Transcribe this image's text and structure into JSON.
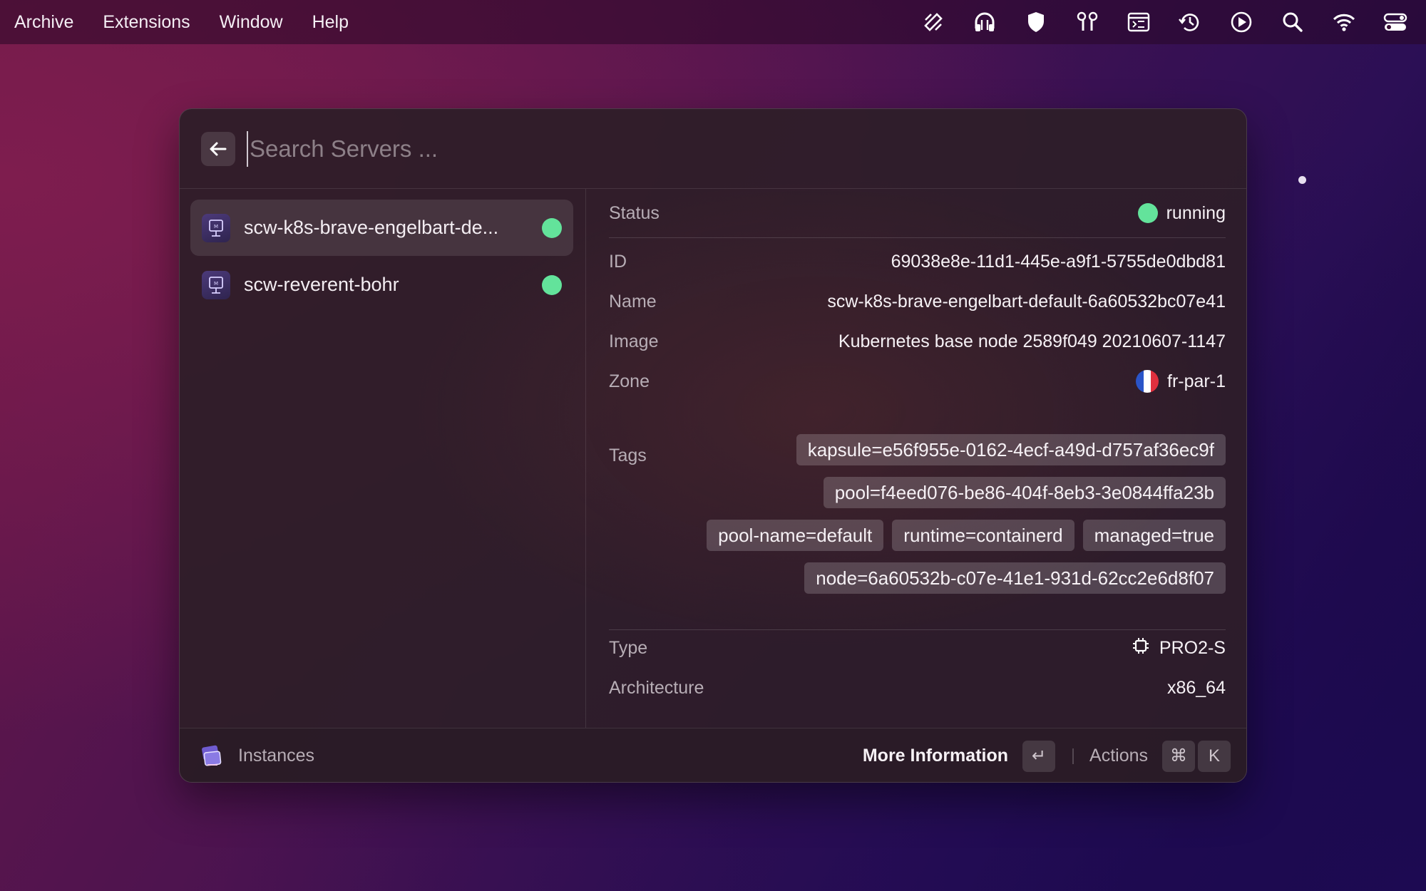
{
  "menubar": {
    "items": [
      "Archive",
      "Extensions",
      "Window",
      "Help"
    ],
    "status_icons": [
      "raycast-icon",
      "headphones-icon",
      "shield-icon",
      "airpods-icon",
      "keyboard-window-icon",
      "time-machine-icon",
      "play-circle-icon",
      "search-icon",
      "wifi-icon",
      "control-center-icon"
    ]
  },
  "search": {
    "placeholder": "Search Servers ...",
    "value": ""
  },
  "servers": [
    {
      "name": "scw-k8s-brave-engelbart-de...",
      "status": "running",
      "selected": true
    },
    {
      "name": "scw-reverent-bohr",
      "status": "running",
      "selected": false
    }
  ],
  "details": {
    "status_label": "Status",
    "status_value": "running",
    "id_label": "ID",
    "id_value": "69038e8e-11d1-445e-a9f1-5755de0dbd81",
    "name_label": "Name",
    "name_value": "scw-k8s-brave-engelbart-default-6a60532bc07e41",
    "image_label": "Image",
    "image_value": "Kubernetes base node 2589f049 20210607-1147",
    "zone_label": "Zone",
    "zone_value": "fr-par-1",
    "tags_label": "Tags",
    "tags": [
      "kapsule=e56f955e-0162-4ecf-a49d-d757af36ec9f",
      "pool=f4eed076-be86-404f-8eb3-3e0844ffa23b",
      "pool-name=default",
      "runtime=containerd",
      "managed=true",
      "node=6a60532b-c07e-41e1-931d-62cc2e6d8f07"
    ],
    "type_label": "Type",
    "type_value": "PRO2-S",
    "arch_label": "Architecture",
    "arch_value": "x86_64"
  },
  "footer": {
    "title": "Instances",
    "primary_action": "More Information",
    "primary_key": "↵",
    "secondary_action": "Actions",
    "secondary_keys": [
      "⌘",
      "K"
    ]
  },
  "colors": {
    "status_green": "#63e39b",
    "accent_purple": "#4c3a7a"
  }
}
